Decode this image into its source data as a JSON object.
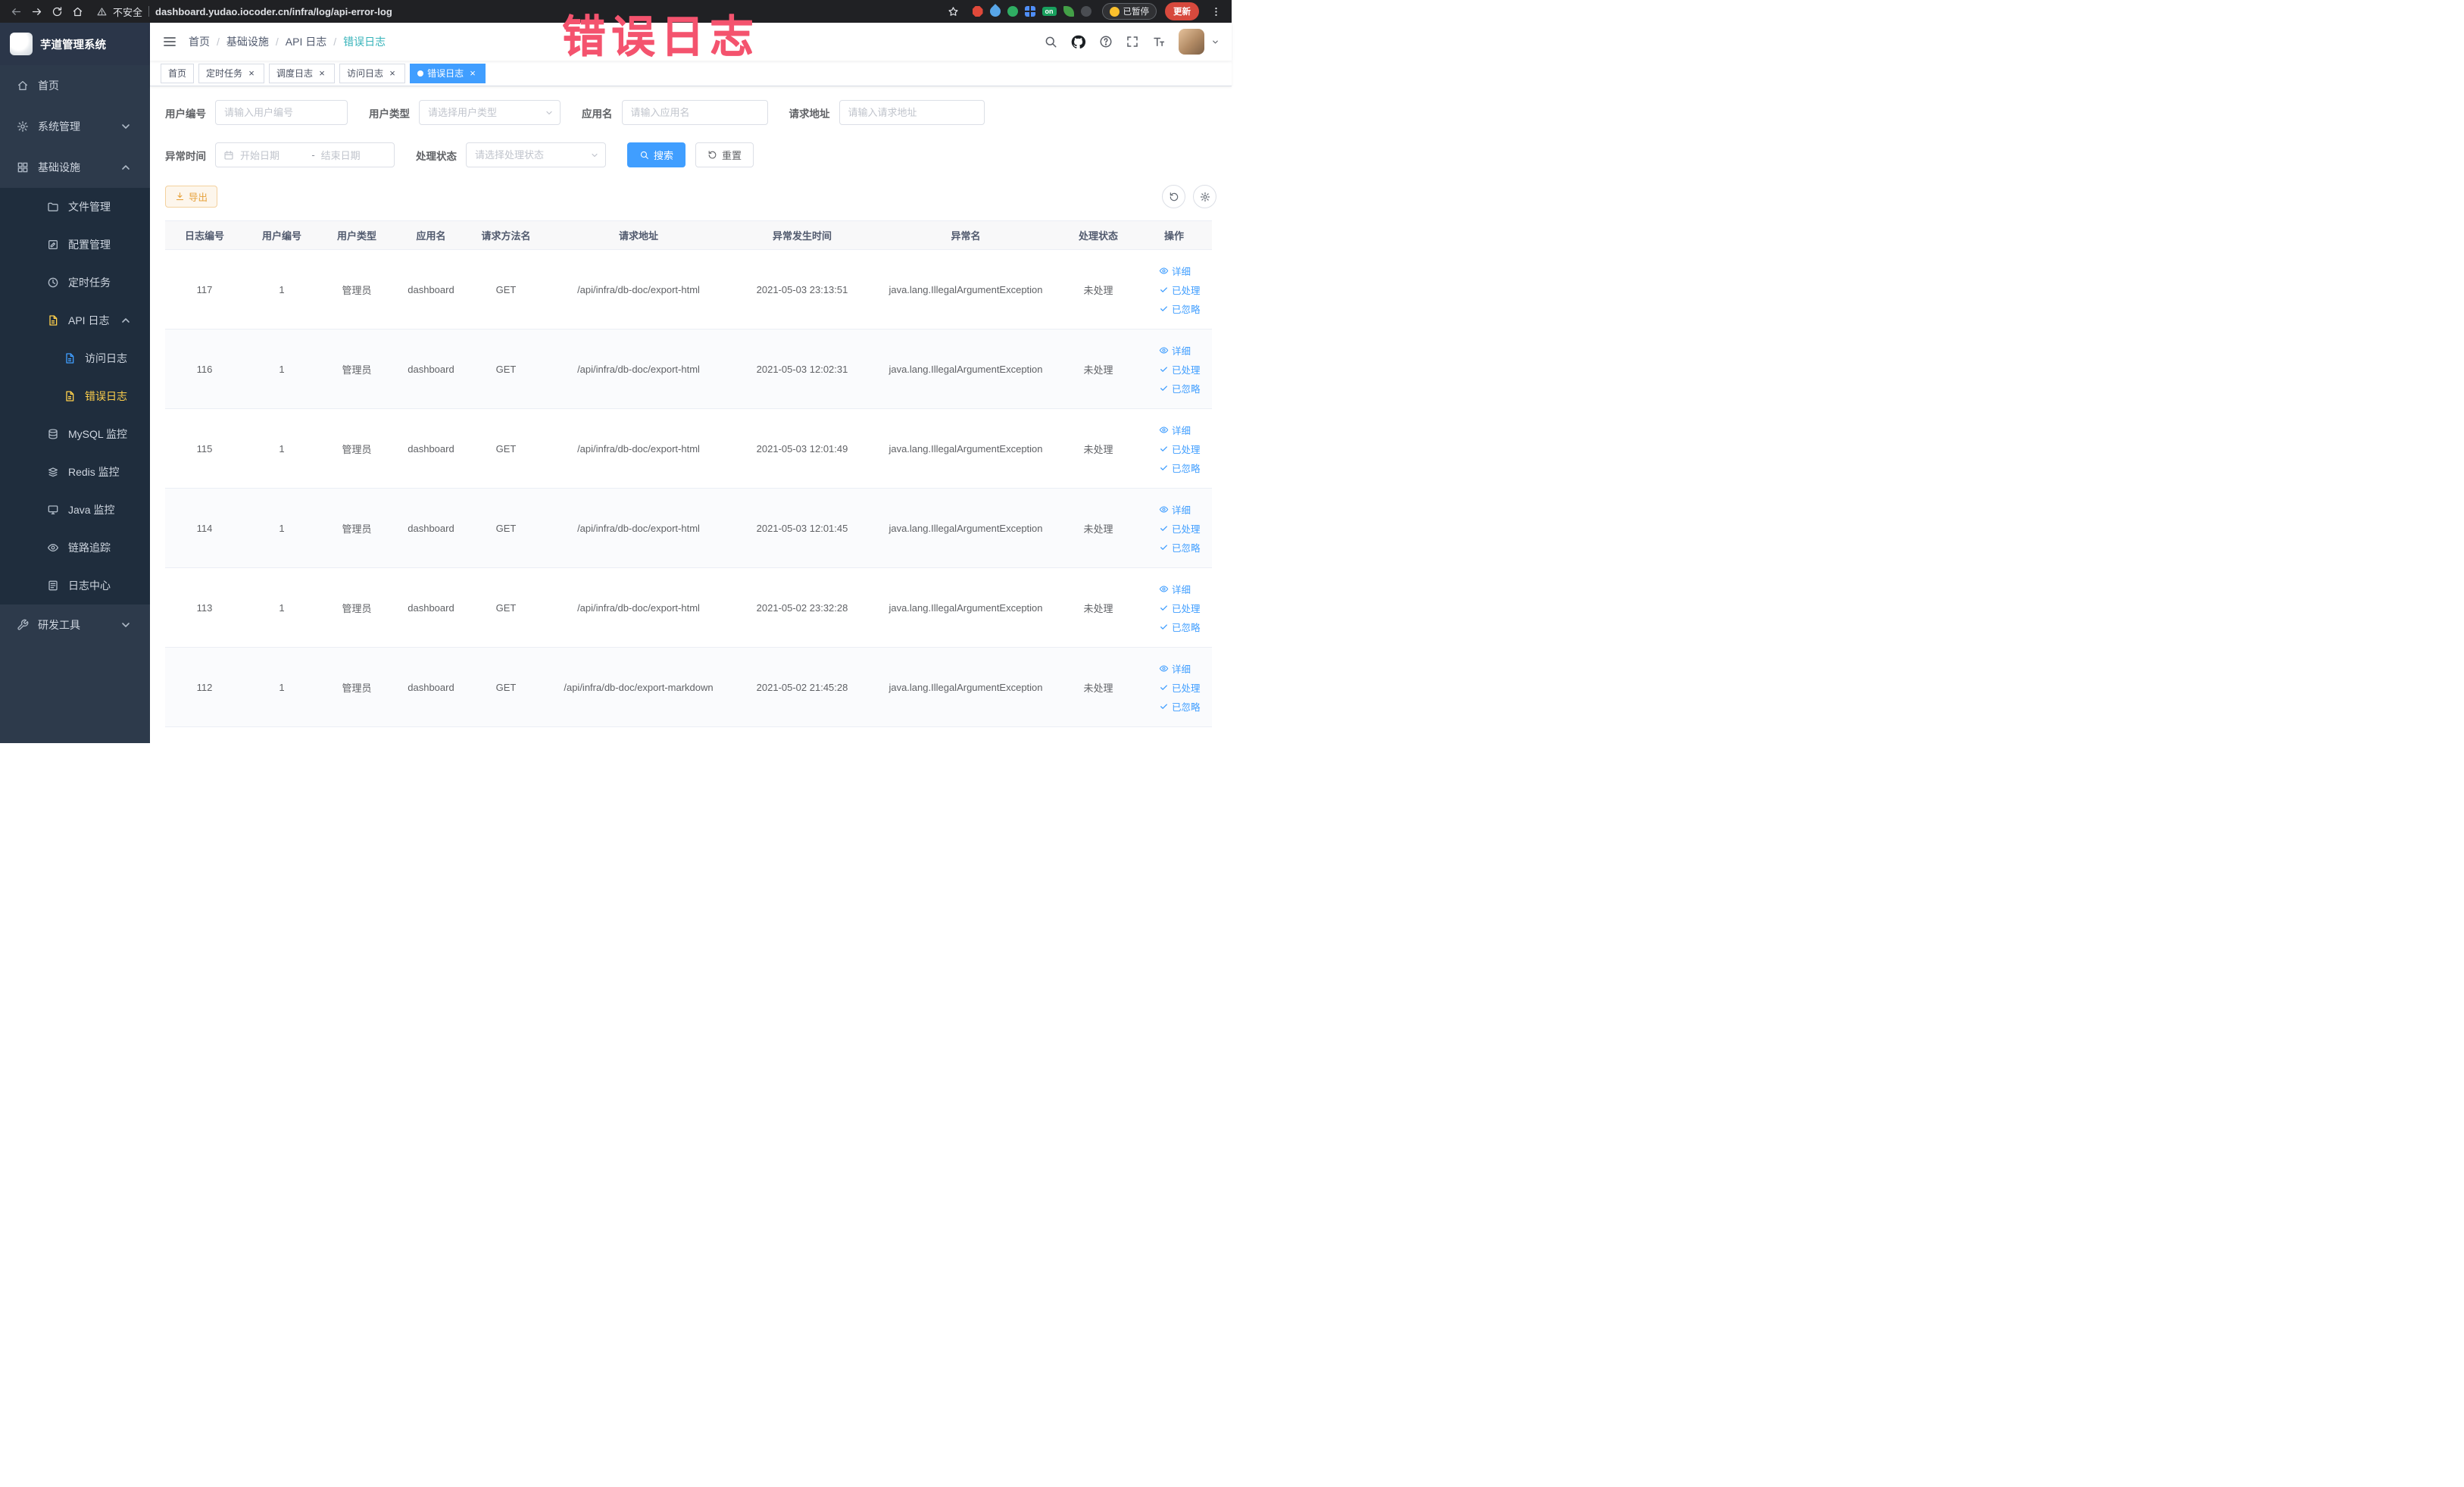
{
  "colors": {
    "primary": "#409eff",
    "sidebar_bg": "#2d3a4b",
    "submenu_bg": "#1f2d3d",
    "active_menu": "#ffd04b",
    "breadcrumb_active": "#36b3ba",
    "annotation": "#f4536e",
    "export_text": "#e6a23c",
    "update_button": "#d7493d"
  },
  "annotation": "错误日志",
  "browser": {
    "security_label": "不安全",
    "url": "dashboard.yudao.iocoder.cn/infra/log/api-error-log",
    "paused_badge": "已暂停",
    "update_label": "更新",
    "extensions": [
      {
        "name": "red-octagon-extension-icon",
        "shape": "octagon",
        "color": "#e0493a"
      },
      {
        "name": "blue-drop-extension-icon",
        "shape": "drop",
        "color": "#58a6e8"
      },
      {
        "name": "green-circle-extension-icon",
        "shape": "circle",
        "color": "#2fae63"
      },
      {
        "name": "blue-grid-extension-icon",
        "shape": "gridshape",
        "color": "#4f8ef7"
      },
      {
        "name": "on-badge-extension-icon",
        "shape": "badge",
        "color": "#18a05e",
        "label": "on"
      },
      {
        "name": "leaf-extension-icon",
        "shape": "leaf",
        "color": "#43a047"
      },
      {
        "name": "paw-extension-icon",
        "shape": "circle",
        "color": "#4a4d52"
      }
    ]
  },
  "sidebar": {
    "logo_title": "芋道管理系统",
    "menu": [
      {
        "icon": "home-icon",
        "label": "首页",
        "level": 1
      },
      {
        "icon": "gear-icon",
        "label": "系统管理",
        "level": 1,
        "arrow": "down"
      },
      {
        "icon": "grid-icon",
        "label": "基础设施",
        "level": 1,
        "arrow": "up"
      },
      {
        "icon": "folder-icon",
        "label": "文件管理",
        "level": 2,
        "sub": true
      },
      {
        "icon": "edit-icon",
        "label": "配置管理",
        "level": 2,
        "sub": true
      },
      {
        "icon": "clock-icon",
        "label": "定时任务",
        "level": 2,
        "sub": true
      },
      {
        "icon": "doc-icon",
        "label": "API 日志",
        "level": 2,
        "sub": true,
        "arrow": "up",
        "icon_color": "#ffd04b"
      },
      {
        "icon": "doc-icon",
        "label": "访问日志",
        "level": 3,
        "sub": true,
        "icon_color": "#409eff"
      },
      {
        "icon": "doc-icon",
        "label": "错误日志",
        "level": 3,
        "sub": true,
        "active": true
      },
      {
        "icon": "db-icon",
        "label": "MySQL 监控",
        "level": 2,
        "sub": true
      },
      {
        "icon": "redis-icon",
        "label": "Redis 监控",
        "level": 2,
        "sub": true
      },
      {
        "icon": "monitor-icon",
        "label": "Java 监控",
        "level": 2,
        "sub": true
      },
      {
        "icon": "eye-icon",
        "label": "链路追踪",
        "level": 2,
        "sub": true
      },
      {
        "icon": "log-icon",
        "label": "日志中心",
        "level": 2,
        "sub": true
      },
      {
        "icon": "wrench-icon",
        "label": "研发工具",
        "level": 1,
        "arrow": "down"
      }
    ]
  },
  "header": {
    "breadcrumb": [
      {
        "label": "首页"
      },
      {
        "label": "基础设施"
      },
      {
        "label": "API 日志"
      },
      {
        "label": "错误日志",
        "active": true
      }
    ]
  },
  "tabs": [
    {
      "label": "首页"
    },
    {
      "label": "定时任务",
      "closable": true
    },
    {
      "label": "调度日志",
      "closable": true
    },
    {
      "label": "访问日志",
      "closable": true
    },
    {
      "label": "错误日志",
      "closable": true,
      "active": true
    }
  ],
  "filters": {
    "user_id": {
      "label": "用户编号",
      "placeholder": "请输入用户编号"
    },
    "user_type": {
      "label": "用户类型",
      "placeholder": "请选择用户类型"
    },
    "app_name": {
      "label": "应用名",
      "placeholder": "请输入应用名"
    },
    "request_url": {
      "label": "请求地址",
      "placeholder": "请输入请求地址"
    },
    "exception_time": {
      "label": "异常时间",
      "start_placeholder": "开始日期",
      "separator": "-",
      "end_placeholder": "结束日期"
    },
    "process_status": {
      "label": "处理状态",
      "placeholder": "请选择处理状态"
    },
    "search_label": "搜索",
    "reset_label": "重置"
  },
  "toolbar": {
    "export_label": "导出"
  },
  "table": {
    "columns": [
      "日志编号",
      "用户编号",
      "用户类型",
      "应用名",
      "请求方法名",
      "请求地址",
      "异常发生时间",
      "异常名",
      "处理状态",
      "操作"
    ],
    "row_actions": [
      {
        "icon": "view-icon",
        "label": "详细"
      },
      {
        "icon": "check-icon",
        "label": "已处理"
      },
      {
        "icon": "check-icon",
        "label": "已忽略"
      }
    ],
    "rows": [
      {
        "id": "117",
        "user_id": "1",
        "user_type": "管理员",
        "app": "dashboard",
        "method": "GET",
        "url": "/api/infra/db-doc/export-html",
        "time": "2021-05-03 23:13:51",
        "exception": "java.lang.IllegalArgumentException",
        "status": "未处理"
      },
      {
        "id": "116",
        "user_id": "1",
        "user_type": "管理员",
        "app": "dashboard",
        "method": "GET",
        "url": "/api/infra/db-doc/export-html",
        "time": "2021-05-03 12:02:31",
        "exception": "java.lang.IllegalArgumentException",
        "status": "未处理"
      },
      {
        "id": "115",
        "user_id": "1",
        "user_type": "管理员",
        "app": "dashboard",
        "method": "GET",
        "url": "/api/infra/db-doc/export-html",
        "time": "2021-05-03 12:01:49",
        "exception": "java.lang.IllegalArgumentException",
        "status": "未处理"
      },
      {
        "id": "114",
        "user_id": "1",
        "user_type": "管理员",
        "app": "dashboard",
        "method": "GET",
        "url": "/api/infra/db-doc/export-html",
        "time": "2021-05-03 12:01:45",
        "exception": "java.lang.IllegalArgumentException",
        "status": "未处理"
      },
      {
        "id": "113",
        "user_id": "1",
        "user_type": "管理员",
        "app": "dashboard",
        "method": "GET",
        "url": "/api/infra/db-doc/export-html",
        "time": "2021-05-02 23:32:28",
        "exception": "java.lang.IllegalArgumentException",
        "status": "未处理"
      },
      {
        "id": "112",
        "user_id": "1",
        "user_type": "管理员",
        "app": "dashboard",
        "method": "GET",
        "url": "/api/infra/db-doc/export-markdown",
        "time": "2021-05-02 21:45:28",
        "exception": "java.lang.IllegalArgumentException",
        "status": "未处理"
      }
    ]
  }
}
